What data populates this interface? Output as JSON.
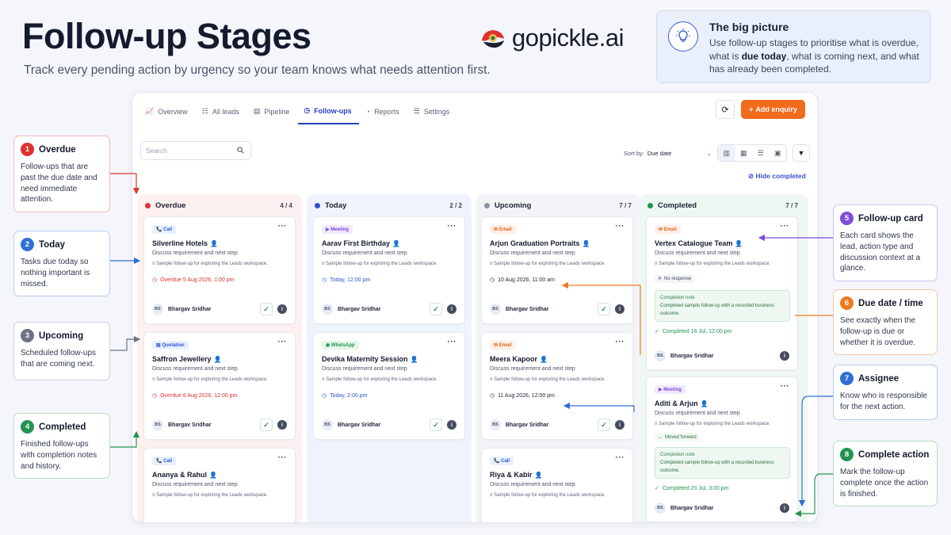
{
  "header": {
    "title": "Follow-up Stages",
    "subtitle": "Track every pending action by urgency so your team knows what needs attention first.",
    "logo_text": "gopickle.ai"
  },
  "big_picture": {
    "title": "The big picture",
    "text_before": "Use follow-up stages to prioritise what is overdue, what is ",
    "text_bold": "due today",
    "text_after": ", what is coming next, and what has already been completed."
  },
  "nav": {
    "items": [
      "Overview",
      "All leads",
      "Pipeline",
      "Follow-ups",
      "Reports",
      "Settings"
    ],
    "active": "Follow-ups"
  },
  "toolbar": {
    "add_label": "Add enquiry",
    "search_placeholder": "Search",
    "sort_label": "Sort by:",
    "sort_value": "Due date",
    "hide_completed": "Hide completed"
  },
  "colors": {
    "overdue": "#e03131",
    "today": "#2f54d6",
    "upcoming": "#8a93a6",
    "completed": "#219451",
    "accent": "#f26a1b"
  },
  "columns": [
    {
      "name": "Overdue",
      "count": "4 / 4"
    },
    {
      "name": "Today",
      "count": "2 / 2"
    },
    {
      "name": "Upcoming",
      "count": "7 / 7"
    },
    {
      "name": "Completed",
      "count": "7 / 7"
    }
  ],
  "common": {
    "line1": "Discuss requirement and next step",
    "line2": "Sample follow-up for exploring the Leads workspace.",
    "assignee": "Bhargav Sridhar",
    "initials": "BS"
  },
  "cards": {
    "c1": {
      "tag": "Call",
      "name": "Silverline Hotels",
      "due": "Overdue 5 Aug 2026, 1:00 pm"
    },
    "c2": {
      "tag": "Quotation",
      "name": "Saffron Jewellery",
      "due": "Overdue 6 Aug 2026, 12:00 pm"
    },
    "c3": {
      "tag": "Call",
      "name": "Ananya & Rahul"
    },
    "c4": {
      "tag": "Meeting",
      "name": "Aarav First Birthday",
      "due": "Today, 12:00 pm"
    },
    "c5": {
      "tag": "WhatsApp",
      "name": "Devika Maternity Session",
      "due": "Today, 2:00 pm"
    },
    "c6": {
      "tag": "Email",
      "name": "Arjun Graduation Portraits",
      "due": "10 Aug 2026, 11:00 am"
    },
    "c7": {
      "tag": "Email",
      "name": "Meera Kapoor",
      "due": "11 Aug 2026, 12:00 pm"
    },
    "c8": {
      "tag": "Call",
      "name": "Riya & Kabir"
    },
    "c9": {
      "tag": "Email",
      "name": "Vertex Catalogue Team",
      "status": "No response",
      "note_label": "Completion note",
      "note": "Completed sample follow-up with a recorded business outcome.",
      "completed": "Completed 16 Jul, 12:00 pm"
    },
    "c10": {
      "tag": "Meeting",
      "name": "Aditi & Arjun",
      "status": "Moved forward",
      "note_label": "Completion note",
      "note": "Completed sample follow-up with a recorded business outcome.",
      "completed": "Completed 20 Jul, 3:00 pm"
    }
  },
  "callouts": [
    {
      "num": "1",
      "title": "Overdue",
      "desc": "Follow-ups that are past the due date and need immediate attention.",
      "color": "#e03131"
    },
    {
      "num": "2",
      "title": "Today",
      "desc": "Tasks due today so nothing important is missed.",
      "color": "#2f6fd6"
    },
    {
      "num": "3",
      "title": "Upcoming",
      "desc": "Scheduled follow-ups that are coming next.",
      "color": "#6b7385"
    },
    {
      "num": "4",
      "title": "Completed",
      "desc": "Finished follow-ups with completion notes and history.",
      "color": "#219451"
    },
    {
      "num": "5",
      "title": "Follow-up card",
      "desc": "Each card shows the lead, action type and discussion context at a glance.",
      "color": "#7c4ddb"
    },
    {
      "num": "6",
      "title": "Due date / time",
      "desc": "See exactly when the follow-up is due or whether it is overdue.",
      "color": "#f07a1e"
    },
    {
      "num": "7",
      "title": "Assignee",
      "desc": "Know who is responsible for the next action.",
      "color": "#2f6fd6"
    },
    {
      "num": "8",
      "title": "Complete action",
      "desc": "Mark the follow-up complete once the action is finished.",
      "color": "#219451"
    }
  ]
}
